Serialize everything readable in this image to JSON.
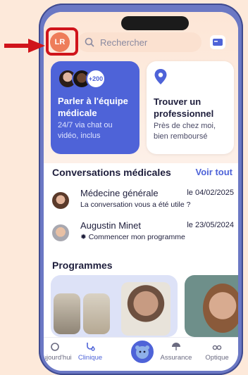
{
  "header": {
    "avatar_initials": "LR",
    "search_placeholder": "Rechercher"
  },
  "cards": {
    "team": {
      "badge": "+200",
      "title": "Parler à l'équipe médicale",
      "subtitle": "24/7 via chat ou vidéo, inclus"
    },
    "pro": {
      "title": "Trouver un professionnel",
      "subtitle": "Près de chez moi, bien remboursé"
    }
  },
  "conversations": {
    "title": "Conversations médicales",
    "see_all": "Voir tout",
    "items": [
      {
        "name": "Médecine générale",
        "date": "le 04/02/2025",
        "sub": "La conversation vous a été utile ?"
      },
      {
        "name": "Augustin Minet",
        "date": "le 23/05/2024",
        "sub": "Commencer mon programme"
      }
    ]
  },
  "programs": {
    "title": "Programmes"
  },
  "tabbar": {
    "items": [
      {
        "label": "Aujourd'hui",
        "icon": "home-icon"
      },
      {
        "label": "Clinique",
        "icon": "stethoscope-icon"
      },
      {
        "label": "",
        "icon": "mascot-icon"
      },
      {
        "label": "Assurance",
        "icon": "umbrella-icon"
      },
      {
        "label": "Optique",
        "icon": "glasses-icon"
      }
    ]
  },
  "colors": {
    "accent": "#4e63d8",
    "avatar": "#ee7d5a",
    "annotation": "#d0141b",
    "phone": "#6b78c4"
  }
}
